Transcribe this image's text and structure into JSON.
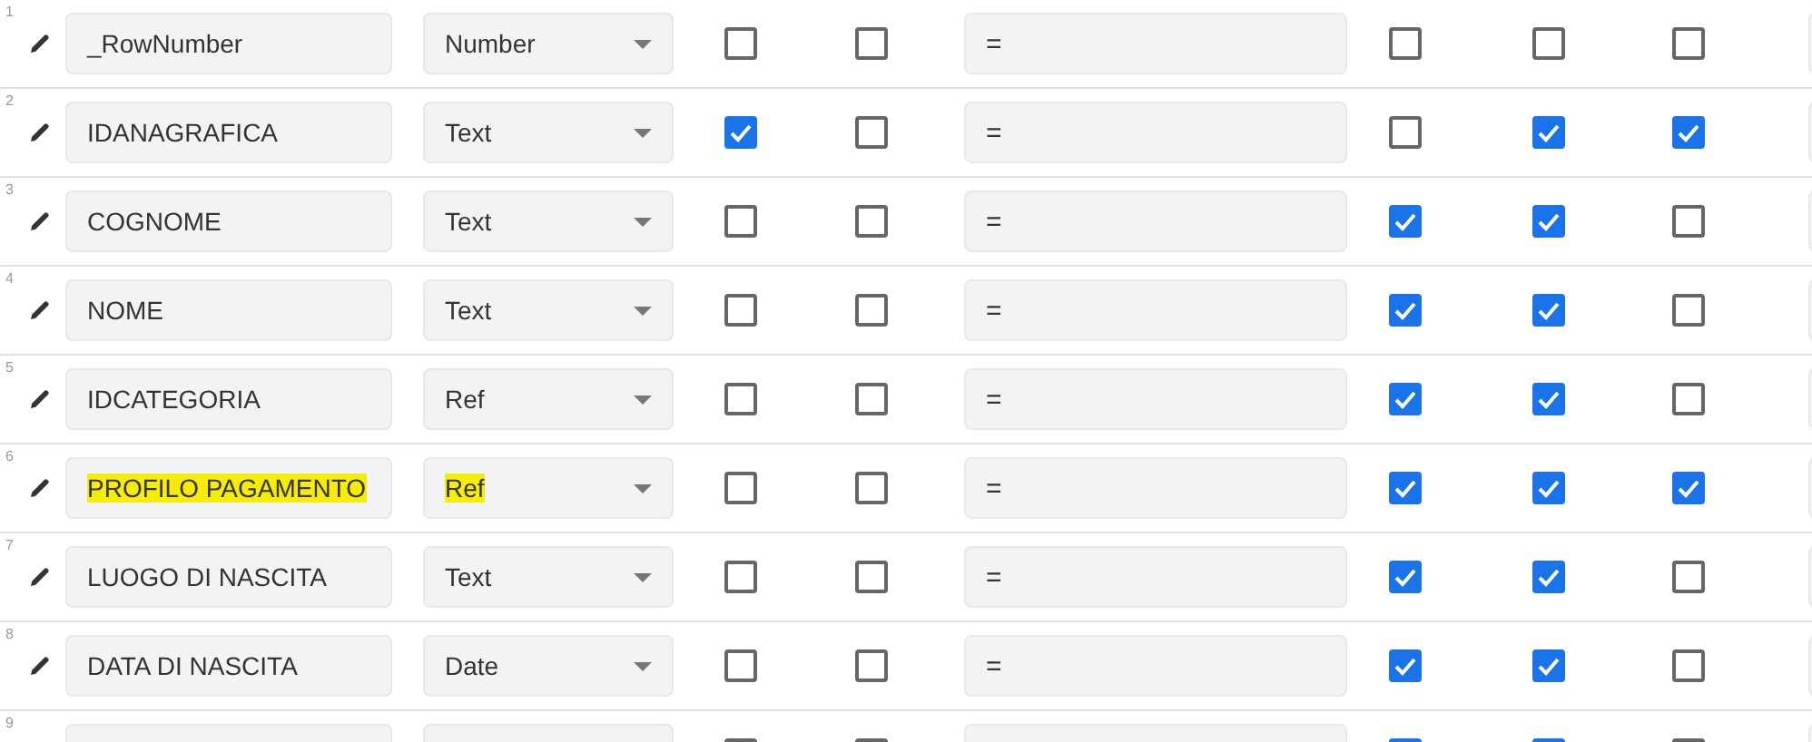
{
  "rows": [
    {
      "number": "1",
      "name": "_RowNumber",
      "type": "Number",
      "formula": "=",
      "highlighted": false,
      "checks": [
        false,
        false,
        false,
        false,
        false
      ]
    },
    {
      "number": "2",
      "name": "IDANAGRAFICA",
      "type": "Text",
      "formula": "=",
      "highlighted": false,
      "checks": [
        true,
        false,
        false,
        true,
        true
      ]
    },
    {
      "number": "3",
      "name": "COGNOME",
      "type": "Text",
      "formula": "=",
      "highlighted": false,
      "checks": [
        false,
        false,
        true,
        true,
        false
      ]
    },
    {
      "number": "4",
      "name": "NOME",
      "type": "Text",
      "formula": "=",
      "highlighted": false,
      "checks": [
        false,
        false,
        true,
        true,
        false
      ]
    },
    {
      "number": "5",
      "name": "IDCATEGORIA",
      "type": "Ref",
      "formula": "=",
      "highlighted": false,
      "checks": [
        false,
        false,
        true,
        true,
        false
      ]
    },
    {
      "number": "6",
      "name": "PROFILO PAGAMENTO",
      "type": "Ref",
      "formula": "=",
      "highlighted": true,
      "checks": [
        false,
        false,
        true,
        true,
        true
      ]
    },
    {
      "number": "7",
      "name": "LUOGO DI NASCITA",
      "type": "Text",
      "formula": "=",
      "highlighted": false,
      "checks": [
        false,
        false,
        true,
        true,
        false
      ]
    },
    {
      "number": "8",
      "name": "DATA DI NASCITA",
      "type": "Date",
      "formula": "=",
      "highlighted": false,
      "checks": [
        false,
        false,
        true,
        true,
        false
      ]
    },
    {
      "number": "9",
      "highlighted": false,
      "checks": [
        false,
        false,
        true,
        true,
        false
      ]
    }
  ]
}
